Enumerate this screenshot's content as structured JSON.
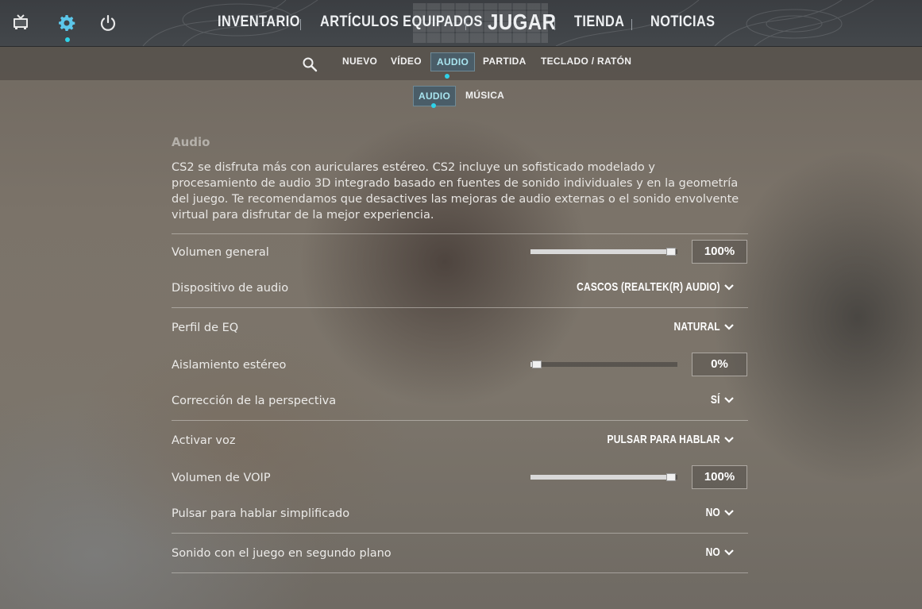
{
  "colors": {
    "accent": "#2fd2e8",
    "active_tab_bg": "#4a5d68",
    "active_tab_text": "#a8e4ef"
  },
  "top_icons": [
    "tv-icon",
    "gear-icon",
    "power-icon"
  ],
  "main_nav": {
    "inventario": "INVENTARIO",
    "articulos": "ARTÍCULOS EQUIPADOS",
    "jugar": "JUGAR",
    "tienda": "TIENDA",
    "noticias": "NOTICIAS"
  },
  "settings_tabs": {
    "nuevo": "NUEVO",
    "video": "VÍDEO",
    "audio": "AUDIO",
    "partida": "PARTIDA",
    "teclado": "TECLADO / RATÓN",
    "active": "AUDIO"
  },
  "sub_tabs": {
    "audio": "AUDIO",
    "musica": "MÚSICA",
    "active": "AUDIO"
  },
  "section": {
    "title": "Audio",
    "description": "CS2 se disfruta más con auriculares estéreo. CS2 incluye un sofisticado modelado y procesamiento de audio 3D integrado basado en fuentes de sonido individuales y en la geometría del juego. Te recomendamos que desactives las mejoras de audio externas o el sonido envolvente virtual para disfrutar de la mejor experiencia."
  },
  "settings": {
    "volumen_general": {
      "label": "Volumen general",
      "value": "100%",
      "level": 1.0
    },
    "dispositivo": {
      "label": "Dispositivo de audio",
      "value": "CASCOS (REALTEK(R) AUDIO)"
    },
    "perfil_eq": {
      "label": "Perfil de EQ",
      "value": "NATURAL"
    },
    "aislamiento": {
      "label": "Aislamiento estéreo",
      "value": "0%",
      "level": 0.0
    },
    "perspectiva": {
      "label": "Corrección de la perspectiva",
      "value": "SÍ"
    },
    "activar_voz": {
      "label": "Activar voz",
      "value": "PULSAR PARA HABLAR"
    },
    "volumen_voip": {
      "label": "Volumen de VOIP",
      "value": "100%",
      "level": 1.0
    },
    "ptt_simplificado": {
      "label": "Pulsar para hablar simplificado",
      "value": "NO"
    },
    "segundo_plano": {
      "label": "Sonido con el juego en segundo plano",
      "value": "NO"
    }
  }
}
